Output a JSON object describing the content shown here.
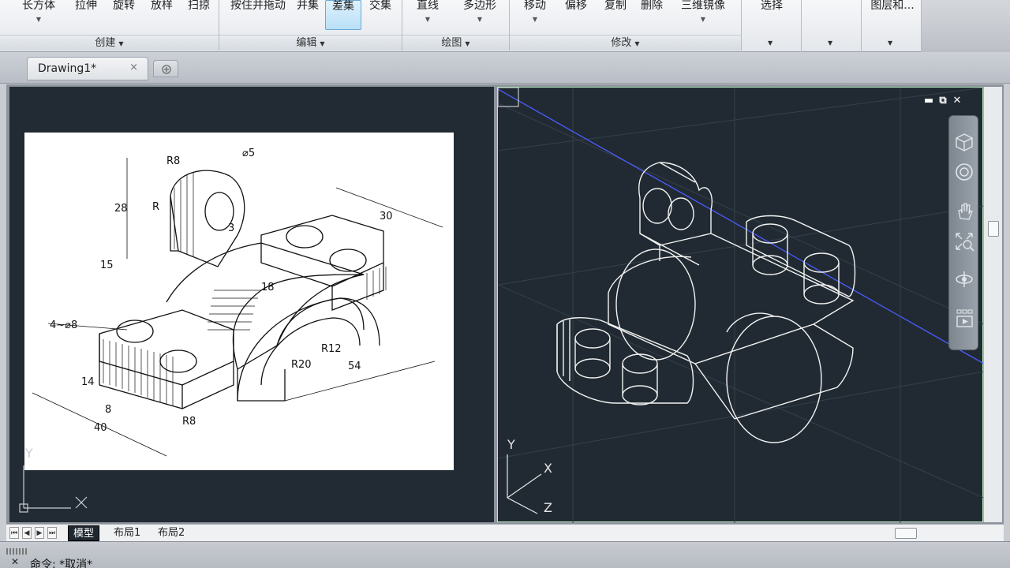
{
  "ribbon": {
    "create": {
      "buttons": [
        "长方体",
        "拉伸",
        "旋转",
        "放样",
        "扫掠"
      ],
      "title": "创建"
    },
    "edit": {
      "buttons": [
        "按住并拖动",
        "并集",
        "差集",
        "交集"
      ],
      "title": "编辑"
    },
    "draw": {
      "buttons": [
        "直线",
        "多边形"
      ],
      "title": "绘图"
    },
    "modify": {
      "buttons": [
        "移动",
        "偏移",
        "复制",
        "删除",
        "三维镜像"
      ],
      "title": "修改"
    },
    "select": {
      "label": "选择"
    },
    "layers": {
      "label": "图层和..."
    }
  },
  "tabs": {
    "doc": "Drawing1*",
    "close": "×"
  },
  "left_drawing": {
    "dims": [
      "R8",
      "⌀5",
      "28",
      "R",
      "3",
      "15",
      "18",
      "30",
      "4~⌀8",
      "14",
      "8",
      "40",
      "R8",
      "R20",
      "R12",
      "54"
    ]
  },
  "ucs": {
    "y": "Y",
    "x": "X",
    "z": "Z"
  },
  "viewport_controls": {
    "minimize": "▬",
    "restore": "⧉",
    "close": "✕"
  },
  "navbar": {
    "icons": [
      "viewcube-icon",
      "steering-wheel-icon",
      "pan-icon",
      "zoom-icon",
      "orbit-icon",
      "showmotion-icon"
    ]
  },
  "layout_tabs": [
    "模型",
    "布局1",
    "布局2"
  ],
  "command": {
    "text": "命令: *取消*"
  }
}
